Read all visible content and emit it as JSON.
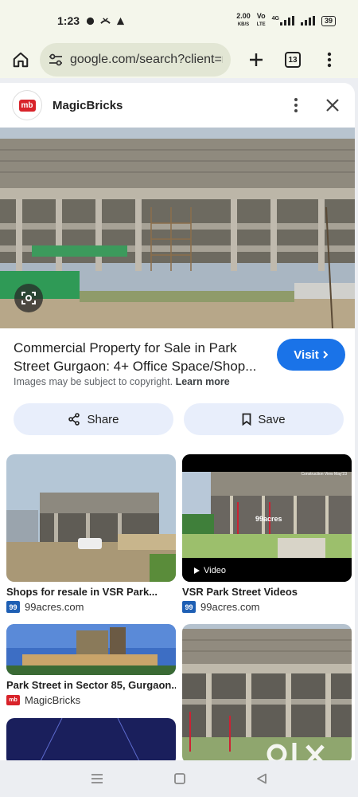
{
  "status_bar": {
    "time": "1:23",
    "net_speed_top": "2.00",
    "net_speed_unit": "KB/S",
    "volte_top": "Vo",
    "volte_bottom": "LTE",
    "network": "4G",
    "battery": "39"
  },
  "browser": {
    "url": "google.com/search?client=m",
    "tabs_count": "13"
  },
  "result": {
    "source_name": "MagicBricks",
    "source_logo_text": "mb",
    "title": "Commercial Property for Sale in Park Street Gurgaon: 4+ Office Space/Shop...",
    "visit_label": "Visit",
    "copyright_text": "Images may be subject to copyright.",
    "learn_more_label": "Learn more",
    "share_label": "Share",
    "save_label": "Save"
  },
  "related": [
    {
      "title": "Shops for resale in VSR Park...",
      "source": "99acres.com",
      "favicon": "99",
      "watermark": ""
    },
    {
      "title": "VSR Park Street Videos",
      "source": "99acres.com",
      "favicon": "99",
      "watermark": "99acres",
      "badge": "Video",
      "caption": "Construction View May'23"
    },
    {
      "title": "Park Street in Sector 85, Gurgaon...",
      "source": "MagicBricks",
      "favicon": "mb"
    },
    {
      "title": "",
      "source": ""
    }
  ],
  "watermark_logo": "olx",
  "colors": {
    "accent": "#1a73e8",
    "chrome_bg": "#f4f6eb",
    "chip_bg": "#e8eefb",
    "magicbricks_red": "#d8232a",
    "acres_blue": "#1e5fb4"
  },
  "icons": [
    "home-icon",
    "tune-icon",
    "plus-icon",
    "tabs-icon",
    "more-vert-icon",
    "close-icon",
    "lens-icon",
    "chevron-right-icon",
    "share-icon",
    "bookmark-icon",
    "play-icon",
    "menu-nav-icon",
    "home-nav-icon",
    "back-nav-icon"
  ]
}
